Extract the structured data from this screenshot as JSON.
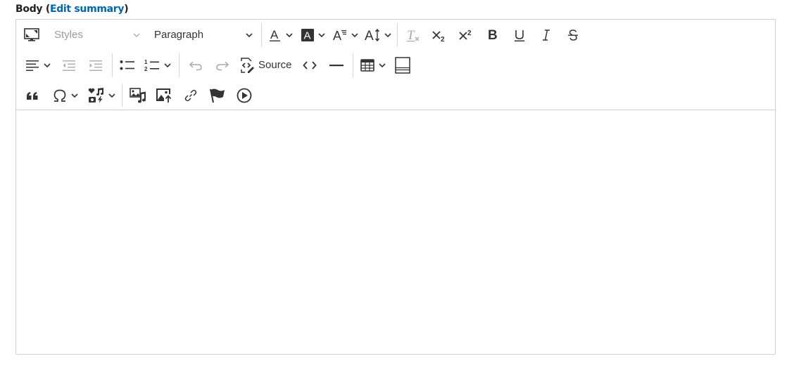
{
  "field": {
    "label": "Body",
    "paren_open": " (",
    "edit_summary_link": "Edit summary",
    "paren_close": ")"
  },
  "toolbar": {
    "row1": {
      "fullscreen": {
        "icon": "fullscreen-icon"
      },
      "styles": {
        "label": "Styles",
        "disabled": true
      },
      "heading": {
        "label": "Paragraph"
      },
      "font_color": {
        "icon": "font-color-icon"
      },
      "font_background": {
        "icon": "font-background-icon"
      },
      "font_family": {
        "icon": "font-family-icon"
      },
      "font_size": {
        "icon": "font-size-icon"
      },
      "remove_format": {
        "icon": "remove-format-icon",
        "disabled": true
      },
      "subscript": {
        "icon": "subscript-icon"
      },
      "superscript": {
        "icon": "superscript-icon"
      },
      "bold": {
        "icon": "bold-icon"
      },
      "underline": {
        "icon": "underline-icon"
      },
      "italic": {
        "icon": "italic-icon"
      },
      "strikethrough": {
        "icon": "strikethrough-icon"
      }
    },
    "row2": {
      "alignment": {
        "icon": "align-left-icon"
      },
      "outdent": {
        "icon": "outdent-icon",
        "disabled": true
      },
      "indent": {
        "icon": "indent-icon",
        "disabled": true
      },
      "bulleted_list": {
        "icon": "bulleted-list-icon"
      },
      "numbered_list": {
        "icon": "numbered-list-icon"
      },
      "undo": {
        "icon": "undo-icon",
        "disabled": true
      },
      "redo": {
        "icon": "redo-icon",
        "disabled": true
      },
      "source": {
        "icon": "source-edit-icon",
        "label": "Source"
      },
      "code": {
        "icon": "code-icon"
      },
      "horizontal_line": {
        "icon": "horizontal-line-icon"
      },
      "table": {
        "icon": "table-icon"
      },
      "page_break": {
        "icon": "page-break-icon"
      }
    },
    "row3": {
      "blockquote": {
        "icon": "blockquote-icon"
      },
      "special_chars": {
        "icon": "omega-icon"
      },
      "media_library": {
        "icon": "media-library-icon"
      },
      "insert_media": {
        "icon": "insert-media-icon"
      },
      "upload_image": {
        "icon": "image-upload-icon"
      },
      "link": {
        "icon": "link-icon"
      },
      "anchor": {
        "icon": "anchor-flag-icon"
      },
      "video": {
        "icon": "play-icon"
      }
    }
  },
  "content": {
    "text": ""
  }
}
